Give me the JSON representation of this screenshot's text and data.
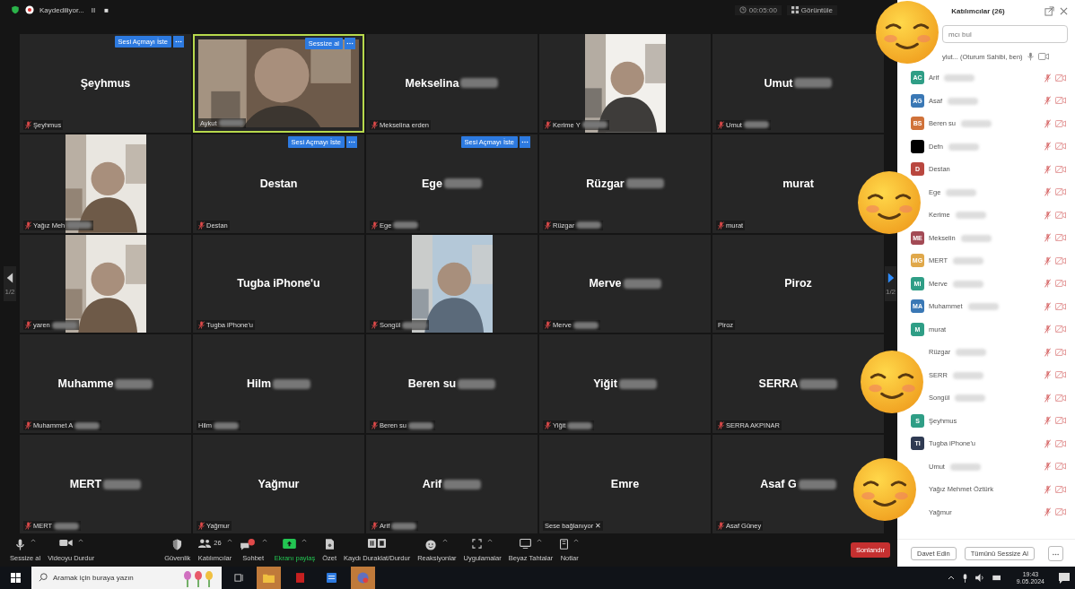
{
  "top_bar": {
    "recording": "Kaydediliyor...",
    "pause": "II",
    "stop": "■",
    "timer": "00:05:00",
    "view": "Görüntüle"
  },
  "pager": {
    "left": "1/2",
    "right": "1/2"
  },
  "tiles": [
    {
      "kind": "name",
      "name": "Şeyhmus",
      "label": "Şeyhmus",
      "muted": true,
      "name_blur": false,
      "label_blur": false,
      "speaking": false,
      "action": "Sesi Açmayı İste"
    },
    {
      "kind": "video",
      "label": "Aykut",
      "muted": false,
      "label_blur": true,
      "speaking": true,
      "action": "Sessize al"
    },
    {
      "kind": "name",
      "name": "Mekselina",
      "label": "Mekselina erden",
      "muted": true,
      "name_blur": true,
      "label_blur": false,
      "speaking": false
    },
    {
      "kind": "video",
      "label": "Kerime Y",
      "muted": true,
      "label_blur": true,
      "speaking": false
    },
    {
      "kind": "name",
      "name": "Umut",
      "label": "Umut",
      "muted": true,
      "name_blur": true,
      "label_blur": true,
      "speaking": false
    },
    {
      "kind": "video",
      "label": "Yağız Meh",
      "muted": true,
      "label_blur": true,
      "speaking": false
    },
    {
      "kind": "name",
      "name": "Destan",
      "label": "Destan",
      "muted": true,
      "name_blur": false,
      "label_blur": false,
      "speaking": false,
      "action": "Sesi Açmayı İste"
    },
    {
      "kind": "name",
      "name": "Ege",
      "label": "Ege",
      "muted": true,
      "name_blur": true,
      "label_blur": true,
      "speaking": false,
      "action": "Sesi Açmayı İste"
    },
    {
      "kind": "name",
      "name": "Rüzgar",
      "label": "Rüzgar",
      "muted": true,
      "name_blur": true,
      "label_blur": true,
      "speaking": false
    },
    {
      "kind": "name",
      "name": "murat",
      "label": "murat",
      "muted": true,
      "name_blur": false,
      "label_blur": false,
      "speaking": false
    },
    {
      "kind": "video",
      "label": "yaren",
      "muted": true,
      "label_blur": true,
      "speaking": false
    },
    {
      "kind": "name",
      "name": "Tugba iPhone'u",
      "label": "Tugba iPhone'u",
      "muted": true,
      "name_blur": false,
      "label_blur": false,
      "speaking": false
    },
    {
      "kind": "video",
      "label": "Songül",
      "muted": true,
      "label_blur": true,
      "speaking": false
    },
    {
      "kind": "name",
      "name": "Merve",
      "label": "Merve",
      "muted": true,
      "name_blur": true,
      "label_blur": true,
      "speaking": false
    },
    {
      "kind": "name",
      "name": "Piroz",
      "label": "Piroz",
      "muted": false,
      "name_blur": false,
      "label_blur": false,
      "speaking": false
    },
    {
      "kind": "name",
      "name": "Muhamme",
      "label": "Muhammet A",
      "muted": true,
      "name_blur": true,
      "label_blur": true,
      "speaking": false
    },
    {
      "kind": "name",
      "name": "Hilm",
      "label": "Hilm",
      "muted": false,
      "name_blur": true,
      "label_blur": true,
      "speaking": false
    },
    {
      "kind": "name",
      "name": "Beren su",
      "label": "Beren su",
      "muted": true,
      "name_blur": true,
      "label_blur": true,
      "speaking": false
    },
    {
      "kind": "name",
      "name": "Yiğit",
      "label": "Yiğit",
      "muted": true,
      "name_blur": true,
      "label_blur": true,
      "speaking": false
    },
    {
      "kind": "name",
      "name": "SERRA",
      "label": "SERRA AKPINAR",
      "muted": true,
      "name_blur": true,
      "label_blur": false,
      "speaking": false
    },
    {
      "kind": "name",
      "name": "MERT",
      "label": "MERT",
      "muted": true,
      "name_blur": true,
      "label_blur": true,
      "speaking": false
    },
    {
      "kind": "name",
      "name": "Yağmur",
      "label": "Yağmur",
      "muted": true,
      "name_blur": false,
      "label_blur": false,
      "speaking": false
    },
    {
      "kind": "name",
      "name": "Arif",
      "label": "Arif",
      "muted": true,
      "name_blur": true,
      "label_blur": true,
      "speaking": false
    },
    {
      "kind": "name",
      "name": "Emre",
      "label": "Sese bağlanıyor ✕",
      "muted": false,
      "name_blur": false,
      "label_blur": false,
      "speaking": false
    },
    {
      "kind": "name",
      "name": "Asaf G",
      "label": "Asaf Güney",
      "muted": true,
      "name_blur": true,
      "label_blur": false,
      "speaking": false
    }
  ],
  "toolbar": [
    {
      "kind": "mic",
      "label": "Sessize al",
      "caret": true
    },
    {
      "kind": "video",
      "label": "Videoyu Durdur",
      "caret": true
    },
    {
      "kind": "security",
      "label": "Güvenlik",
      "caret": false
    },
    {
      "kind": "participants",
      "label": "Katılımcılar",
      "count": "26",
      "caret": true
    },
    {
      "kind": "chat",
      "label": "Sohbet",
      "caret": true
    },
    {
      "kind": "share",
      "label": "Ekranı paylaş",
      "caret": true
    },
    {
      "kind": "summary",
      "label": "Özet",
      "caret": false
    },
    {
      "kind": "record",
      "label": "Kaydı Duraklat/Durdur",
      "caret": false
    },
    {
      "kind": "reactions",
      "label": "Reaksiyonlar",
      "caret": true
    },
    {
      "kind": "apps",
      "label": "Uygulamalar",
      "caret": true
    },
    {
      "kind": "whiteboard",
      "label": "Beyaz Tahtalar",
      "caret": true
    },
    {
      "kind": "notes",
      "label": "Notlar",
      "caret": true
    }
  ],
  "end_button": "Sonlandır",
  "panel": {
    "title": "Katılımcılar (26)",
    "search": {
      "placeholder": "mcı bul"
    },
    "host": {
      "name": "ylut... (Oturum Sahibi, ben)"
    },
    "participants": [
      {
        "name": "Arif",
        "initials": "AC",
        "color": "#2f9e86",
        "blur": true
      },
      {
        "name": "Asaf",
        "initials": "AG",
        "color": "#3a78b5",
        "blur": true
      },
      {
        "name": "Beren su",
        "initials": "BS",
        "color": "#d0723a",
        "blur": true
      },
      {
        "name": "Defn",
        "color": "#000000",
        "blur": true
      },
      {
        "name": "Destan",
        "initials": "D",
        "color": "#b9473f",
        "blur": false
      },
      {
        "name": "Ege",
        "blur": true
      },
      {
        "name": "Kerime",
        "blur": true
      },
      {
        "name": "Mekselin",
        "initials": "ME",
        "color": "#a34a55",
        "blur": true
      },
      {
        "name": "MERT",
        "initials": "MG",
        "color": "#e0a84a",
        "blur": true
      },
      {
        "name": "Merve",
        "initials": "MI",
        "color": "#2f9e86",
        "blur": true
      },
      {
        "name": "Muhammet",
        "initials": "MA",
        "color": "#3a78b5",
        "blur": true
      },
      {
        "name": "murat",
        "initials": "M",
        "color": "#2f9e86",
        "blur": false
      },
      {
        "name": "Rüzgar",
        "blur": true
      },
      {
        "name": "SERR",
        "blur": true
      },
      {
        "name": "Songül",
        "blur": true
      },
      {
        "name": "Şeyhmus",
        "initials": "S",
        "color": "#2f9e86",
        "blur": false
      },
      {
        "name": "Tugba iPhone'u",
        "initials": "TI",
        "color": "#2f3a52",
        "blur": false
      },
      {
        "name": "Umut",
        "blur": true
      },
      {
        "name": "Yağız Mehmet Öztürk",
        "blur": false
      },
      {
        "name": "Yağmur",
        "blur": false
      }
    ],
    "buttons": [
      "Davet Edin",
      "Tümünü Sessize Al"
    ]
  },
  "taskbar": {
    "search": {
      "placeholder": "Aramak için buraya yazın"
    },
    "time": "19:43",
    "date": "9.05.2024"
  }
}
